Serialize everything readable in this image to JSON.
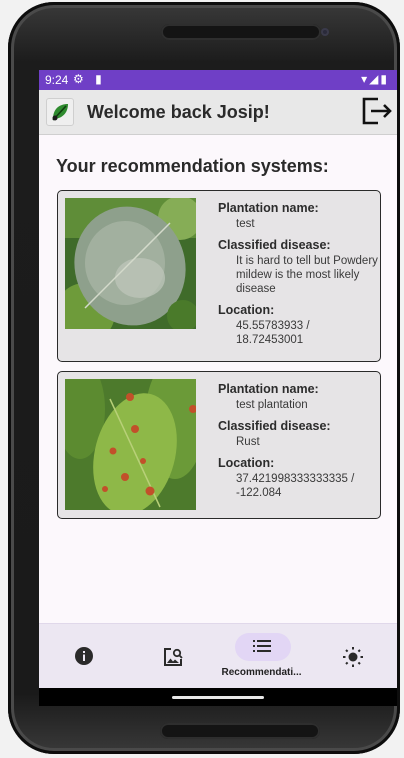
{
  "status_bar": {
    "time": "9:24",
    "left_icons": "⚙ ▮",
    "right_icons": "▾◢▮"
  },
  "app_bar": {
    "title": "Welcome back Josip!"
  },
  "main": {
    "section_title": "Your recommendation systems:",
    "cards": [
      {
        "plantation_label": "Plantation name:",
        "plantation_value": "test",
        "disease_label": "Classified disease:",
        "disease_value": "It is hard to tell but Powdery mildew is the most likely disease",
        "location_label": "Location:",
        "location_value": "45.55783933 / 18.72453001"
      },
      {
        "plantation_label": "Plantation name:",
        "plantation_value": "test plantation",
        "disease_label": "Classified disease:",
        "disease_value": "Rust",
        "location_label": "Location:",
        "location_value": "37.421998333333335 / -122.084"
      }
    ]
  },
  "bottom_nav": {
    "items": [
      {
        "icon": "info-icon",
        "label": ""
      },
      {
        "icon": "image-search-icon",
        "label": ""
      },
      {
        "icon": "list-icon",
        "label": "Recommendati...",
        "active": true
      },
      {
        "icon": "brightness-icon",
        "label": ""
      }
    ]
  },
  "colors": {
    "status_bar": "#6f3fc6",
    "active_pill": "#e2d6f5",
    "nav_bg": "#ece7f2"
  }
}
